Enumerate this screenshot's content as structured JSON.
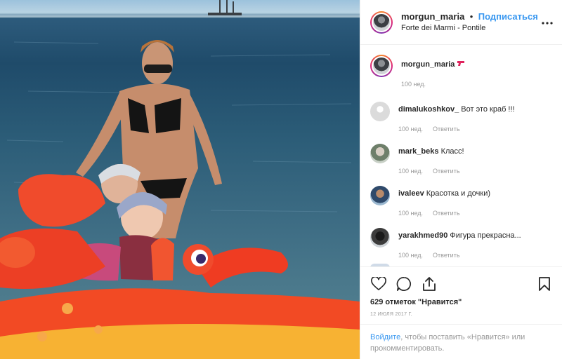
{
  "post": {
    "username": "morgun_maria",
    "dot": "•",
    "follow_label": "Подписаться",
    "location": "Forte dei Marmi - Pontile",
    "more_icon": "more-horizontal-icon"
  },
  "caption": {
    "username": "morgun_maria",
    "emoji": "water-pistol-icon",
    "time": "100 нед."
  },
  "comments": [
    {
      "username": "dimalukoshkov_",
      "text": "Вот это краб !!!",
      "time": "100 нед.",
      "reply": "Ответить"
    },
    {
      "username": "mark_beks",
      "text": "Класс!",
      "time": "100 нед.",
      "reply": "Ответить"
    },
    {
      "username": "ivaleev",
      "text": "Красотка и дочки)",
      "time": "100 нед.",
      "reply": "Ответить"
    },
    {
      "username": "yarakhmed90",
      "text": "Фигура прекрасна...",
      "time": "100 нед.",
      "reply": "Ответить"
    }
  ],
  "actions": {
    "likes": "629 отметок \"Нравится\"",
    "date": "12 ИЮЛЯ 2017 Г."
  },
  "login_prompt": {
    "link": "Войдите",
    "text": ", чтобы поставить «Нравится» или прокомментировать."
  },
  "colors": {
    "accent": "#3897f0",
    "muted": "#999999",
    "text": "#262626"
  }
}
